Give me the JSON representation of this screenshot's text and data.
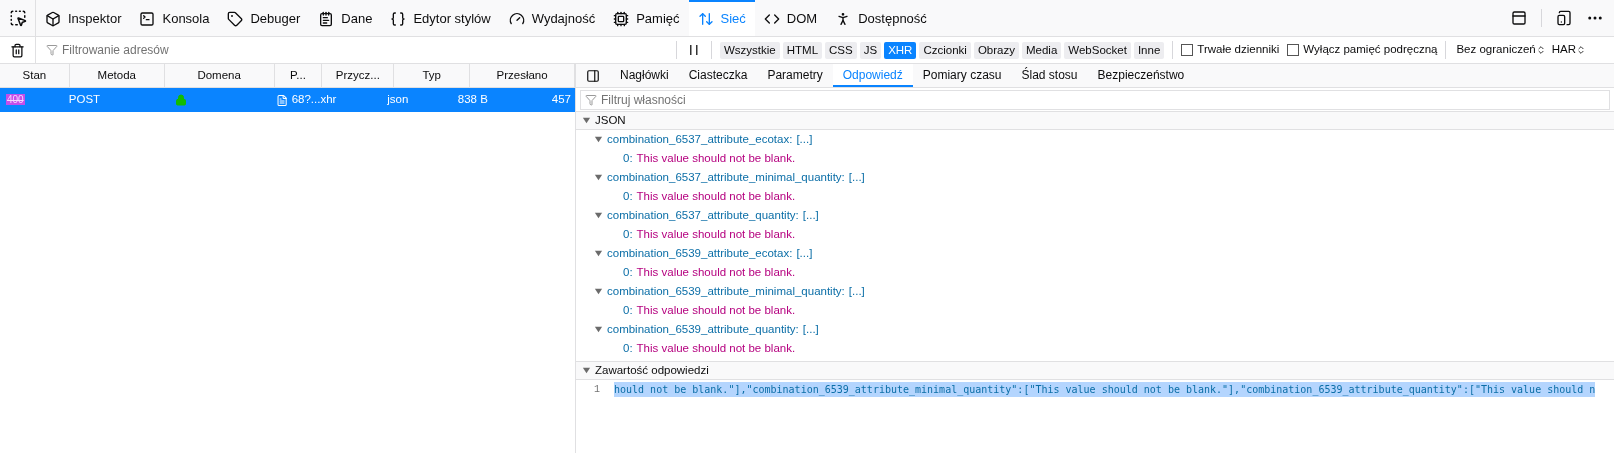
{
  "toolbox": {
    "tools": [
      {
        "label": "Inspektor",
        "selected": false
      },
      {
        "label": "Konsola",
        "selected": false
      },
      {
        "label": "Debuger",
        "selected": false
      },
      {
        "label": "Dane",
        "selected": false
      },
      {
        "label": "Edytor stylów",
        "selected": false
      },
      {
        "label": "Wydajność",
        "selected": false
      },
      {
        "label": "Pamięć",
        "selected": false
      },
      {
        "label": "Sieć",
        "selected": true
      },
      {
        "label": "DOM",
        "selected": false
      },
      {
        "label": "Dostępność",
        "selected": false
      }
    ]
  },
  "filter_bar": {
    "placeholder": "Filtrowanie adresów",
    "types": [
      {
        "label": "Wszystkie",
        "selected": false
      },
      {
        "label": "HTML",
        "selected": false
      },
      {
        "label": "CSS",
        "selected": false
      },
      {
        "label": "JS",
        "selected": false
      },
      {
        "label": "XHR",
        "selected": true
      },
      {
        "label": "Czcionki",
        "selected": false
      },
      {
        "label": "Obrazy",
        "selected": false
      },
      {
        "label": "Media",
        "selected": false
      },
      {
        "label": "WebSocket",
        "selected": false
      },
      {
        "label": "Inne",
        "selected": false
      }
    ],
    "options": [
      {
        "label": "Trwałe dzienniki",
        "checked": false
      },
      {
        "label": "Wyłącz pamięć podręczną",
        "checked": false
      }
    ],
    "throttling": "Bez ograniczeń",
    "har": "HAR"
  },
  "requests": {
    "columns": [
      "Stan",
      "Metoda",
      "Domena",
      "P...",
      "Przycz...",
      "Typ",
      "Przesłano"
    ],
    "rows": [
      {
        "selected": true,
        "status": "400",
        "method": "POST",
        "secure": true,
        "file": "68?...",
        "cause": "xhr",
        "type": "json",
        "transferred": "838 B",
        "size": "457"
      }
    ]
  },
  "details": {
    "tabs": [
      {
        "label": "Nagłówki",
        "selected": false
      },
      {
        "label": "Ciasteczka",
        "selected": false
      },
      {
        "label": "Parametry",
        "selected": false
      },
      {
        "label": "Odpowiedź",
        "selected": true
      },
      {
        "label": "Pomiary czasu",
        "selected": false
      },
      {
        "label": "Ślad stosu",
        "selected": false
      },
      {
        "label": "Bezpieczeństwo",
        "selected": false
      }
    ],
    "filter_placeholder": "Filtruj własności",
    "json": {
      "title": "JSON",
      "expanded": true,
      "entries": [
        {
          "key": "combination_6537_attribute_ecotax:",
          "preview": "[...]",
          "expanded": true,
          "items": [
            {
              "index": "0:",
              "value": "This value should not be blank."
            }
          ]
        },
        {
          "key": "combination_6537_attribute_minimal_quantity:",
          "preview": "[...]",
          "expanded": true,
          "items": [
            {
              "index": "0:",
              "value": "This value should not be blank."
            }
          ]
        },
        {
          "key": "combination_6537_attribute_quantity:",
          "preview": "[...]",
          "expanded": true,
          "items": [
            {
              "index": "0:",
              "value": "This value should not be blank."
            }
          ]
        },
        {
          "key": "combination_6539_attribute_ecotax:",
          "preview": "[...]",
          "expanded": true,
          "items": [
            {
              "index": "0:",
              "value": "This value should not be blank."
            }
          ]
        },
        {
          "key": "combination_6539_attribute_minimal_quantity:",
          "preview": "[...]",
          "expanded": true,
          "items": [
            {
              "index": "0:",
              "value": "This value should not be blank."
            }
          ]
        },
        {
          "key": "combination_6539_attribute_quantity:",
          "preview": "[...]",
          "expanded": true,
          "items": [
            {
              "index": "0:",
              "value": "This value should not be blank."
            }
          ]
        }
      ]
    },
    "response": {
      "title": "Zawartość odpowiedzi",
      "expanded": true,
      "lines": [
        {
          "number": "1",
          "text": "hould not be blank.\"],\"combination_6539_attribute_minimal_quantity\":[\"This value should not be blank.\"],\"combination_6539_attribute_quantity\":[\"This value should n",
          "selected": true
        }
      ]
    }
  }
}
